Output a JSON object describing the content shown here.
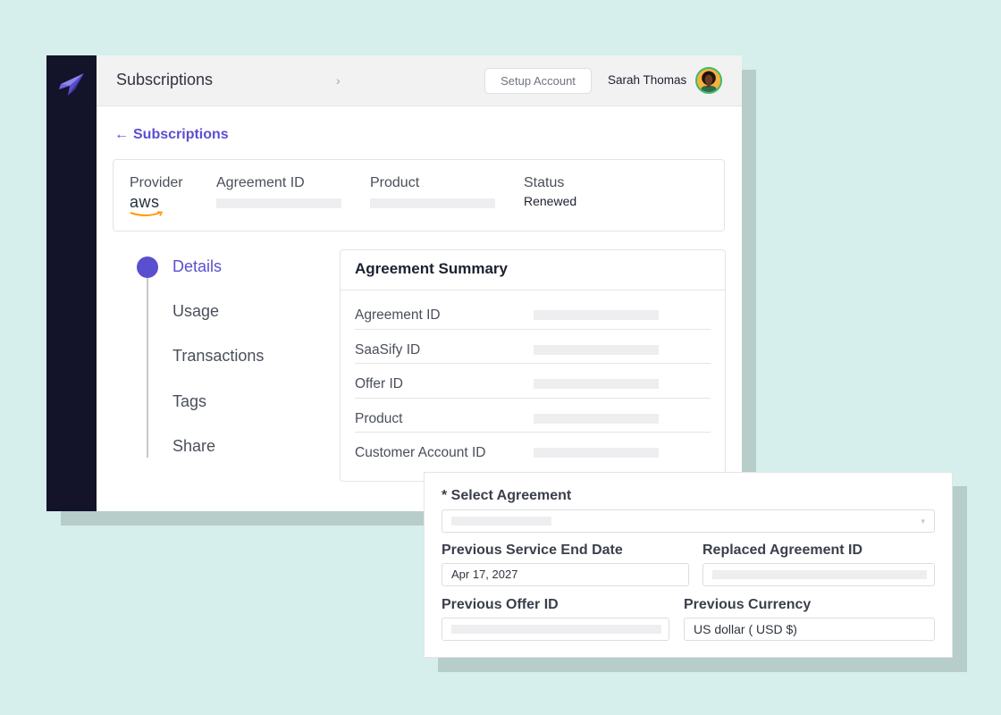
{
  "topbar": {
    "title": "Subscriptions",
    "chevron": "›",
    "setup_button_label": "Setup Account",
    "user_name": "Sarah Thomas"
  },
  "back_link": {
    "arrow": "←",
    "label": "Subscriptions"
  },
  "info_card": {
    "provider_label": "Provider",
    "provider_logo_text": "aws",
    "agreement_id_label": "Agreement ID",
    "product_label": "Product",
    "status_label": "Status",
    "status_value": "Renewed"
  },
  "steps": [
    {
      "label": "Details",
      "active": true
    },
    {
      "label": "Usage",
      "active": false
    },
    {
      "label": "Transactions",
      "active": false
    },
    {
      "label": "Tags",
      "active": false
    },
    {
      "label": "Share",
      "active": false
    }
  ],
  "summary": {
    "title": "Agreement Summary",
    "rows": [
      {
        "label": "Agreement ID"
      },
      {
        "label": "SaaSify ID"
      },
      {
        "label": "Offer ID"
      },
      {
        "label": "Product"
      },
      {
        "label": "Customer Account ID"
      }
    ]
  },
  "form": {
    "select_agreement_label": "* Select Agreement",
    "select_chevron": "▾",
    "prev_service_end_label": "Previous Service End Date",
    "prev_service_end_value": "Apr 17, 2027",
    "replaced_agreement_label": "Replaced Agreement ID",
    "prev_offer_label": "Previous Offer ID",
    "prev_currency_label": "Previous Currency",
    "prev_currency_value": "US dollar ( USD $)"
  },
  "colors": {
    "accent": "#5a4fcf",
    "sidebar": "#13132a",
    "background": "#d6eeec",
    "avatar_ring": "#3fb870"
  },
  "icons": [
    "app-logo-icon",
    "chevron-right-icon",
    "back-arrow-icon",
    "aws-logo-icon",
    "select-chevron-icon"
  ]
}
